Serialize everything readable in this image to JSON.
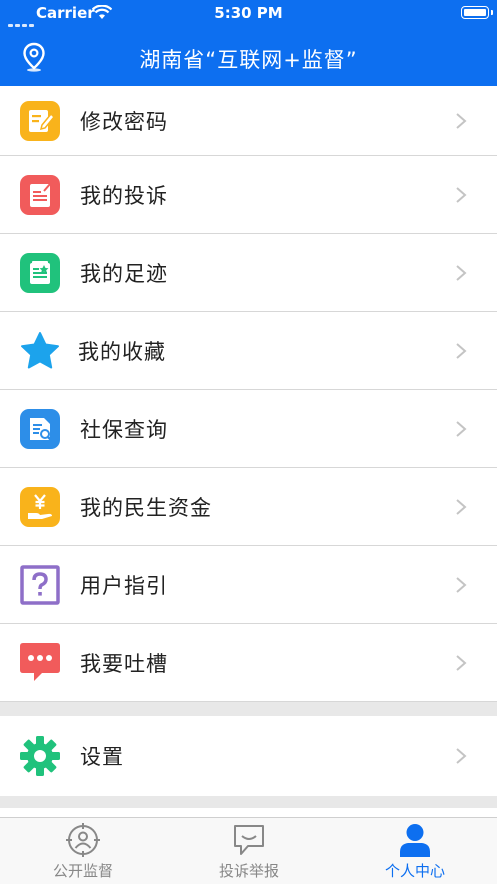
{
  "status_bar": {
    "carrier": "Carrier",
    "time": "5:30 PM"
  },
  "nav": {
    "title": "湖南省“互联网+监督”",
    "left_icon": "location-pin-icon"
  },
  "menu": {
    "items": [
      {
        "label": "修改密码",
        "icon": "edit-password-icon",
        "color": "#f9b31b"
      },
      {
        "label": "我的投诉",
        "icon": "complaint-document-icon",
        "color": "#f15b5b"
      },
      {
        "label": "我的足迹",
        "icon": "footprint-document-icon",
        "color": "#20c27c"
      },
      {
        "label": "我的收藏",
        "icon": "star-icon",
        "color": "#1ca3ec"
      },
      {
        "label": "社保查询",
        "icon": "document-search-icon",
        "color": "#2d8ee8"
      },
      {
        "label": "我的民生资金",
        "icon": "yen-hand-icon",
        "color": "#f9b31b"
      },
      {
        "label": "用户指引",
        "icon": "question-box-icon",
        "color": "#8e6fc8"
      },
      {
        "label": "我要吐槽",
        "icon": "chat-dots-icon",
        "color": "#f15b5b"
      }
    ],
    "settings": {
      "label": "设置",
      "icon": "gear-icon",
      "color": "#20c27c"
    }
  },
  "tabs": [
    {
      "label": "公开监督",
      "icon": "supervise-person-icon",
      "active": false
    },
    {
      "label": "投诉举报",
      "icon": "message-bubble-icon",
      "active": false
    },
    {
      "label": "个人中心",
      "icon": "user-icon",
      "active": true
    }
  ]
}
